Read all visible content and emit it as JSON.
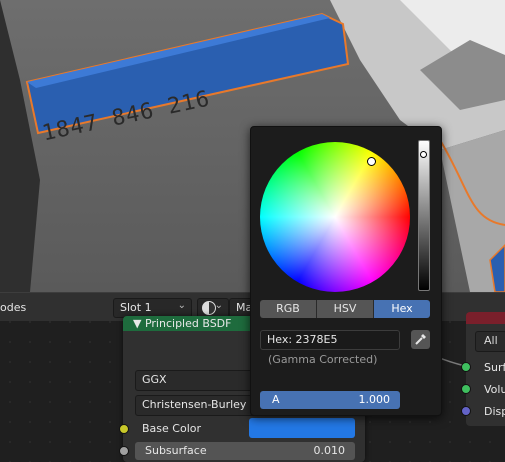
{
  "viewport": {
    "license_plate_text": "1847 846 216"
  },
  "node_editor": {
    "header_partial_label": "odes",
    "slot_dropdown": "Slot 1",
    "material_partial_label": "Ma"
  },
  "node": {
    "title": "Principled BSDF",
    "distribution": "GGX",
    "subsurface_method": "Christensen-Burley",
    "base_color_label": "Base Color",
    "base_color_hex": "#2378e5",
    "subsurface_label": "Subsurface",
    "subsurface_value": "0.010"
  },
  "output_node": {
    "target": "All",
    "sockets": [
      "Surfa",
      "Volu",
      "Disp"
    ]
  },
  "color_picker": {
    "tabs": [
      "RGB",
      "HSV",
      "Hex"
    ],
    "active_tab": "Hex",
    "hex_label": "Hex: 2378E5",
    "gamma_note": "(Gamma Corrected)",
    "alpha_label": "A",
    "alpha_value": "1.000",
    "accent_color": "#4772b3"
  }
}
